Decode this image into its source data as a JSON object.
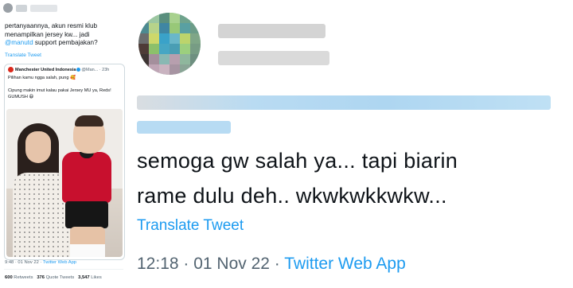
{
  "left_panel": {
    "tweet_text_line1": "pertanyaannya, akun resmi klub",
    "tweet_text_line2": "menampilkan jersey kw... jadi",
    "mention": "@manutd",
    "tweet_text_line3_rest": " support pembajakan?",
    "translate_label": "Translate Tweet",
    "quote": {
      "account_name": "Manchester United Indonesia",
      "handle_time": "@Man... · 23h",
      "line1": "Pilihan kamu ngga salah, pung 🥰",
      "line2": "Cipung makin imut kalau pakai Jersey MU ya, Reds!",
      "line3": "GUMUSH 😆"
    },
    "meta_time": "9:48 · 01 Nov 22 · ",
    "meta_app": "Twitter Web App",
    "stats": {
      "retweets_count": "600",
      "retweets_label": "Retweets",
      "quotes_count": "376",
      "quotes_label": "Quote Tweets",
      "likes_count": "3,547",
      "likes_label": "Likes"
    }
  },
  "right_panel": {
    "main_line1": "semoga gw salah ya... tapi biarin",
    "main_line2": "rame dulu deh.. wkwkwkkwkw...",
    "translate_label": "Translate Tweet",
    "time_date": "12:18 · 01 Nov 22 · ",
    "app": "Twitter Web App"
  },
  "colors": {
    "link": "#1d9bf0",
    "text": "#0f1419",
    "muted": "#536471"
  }
}
